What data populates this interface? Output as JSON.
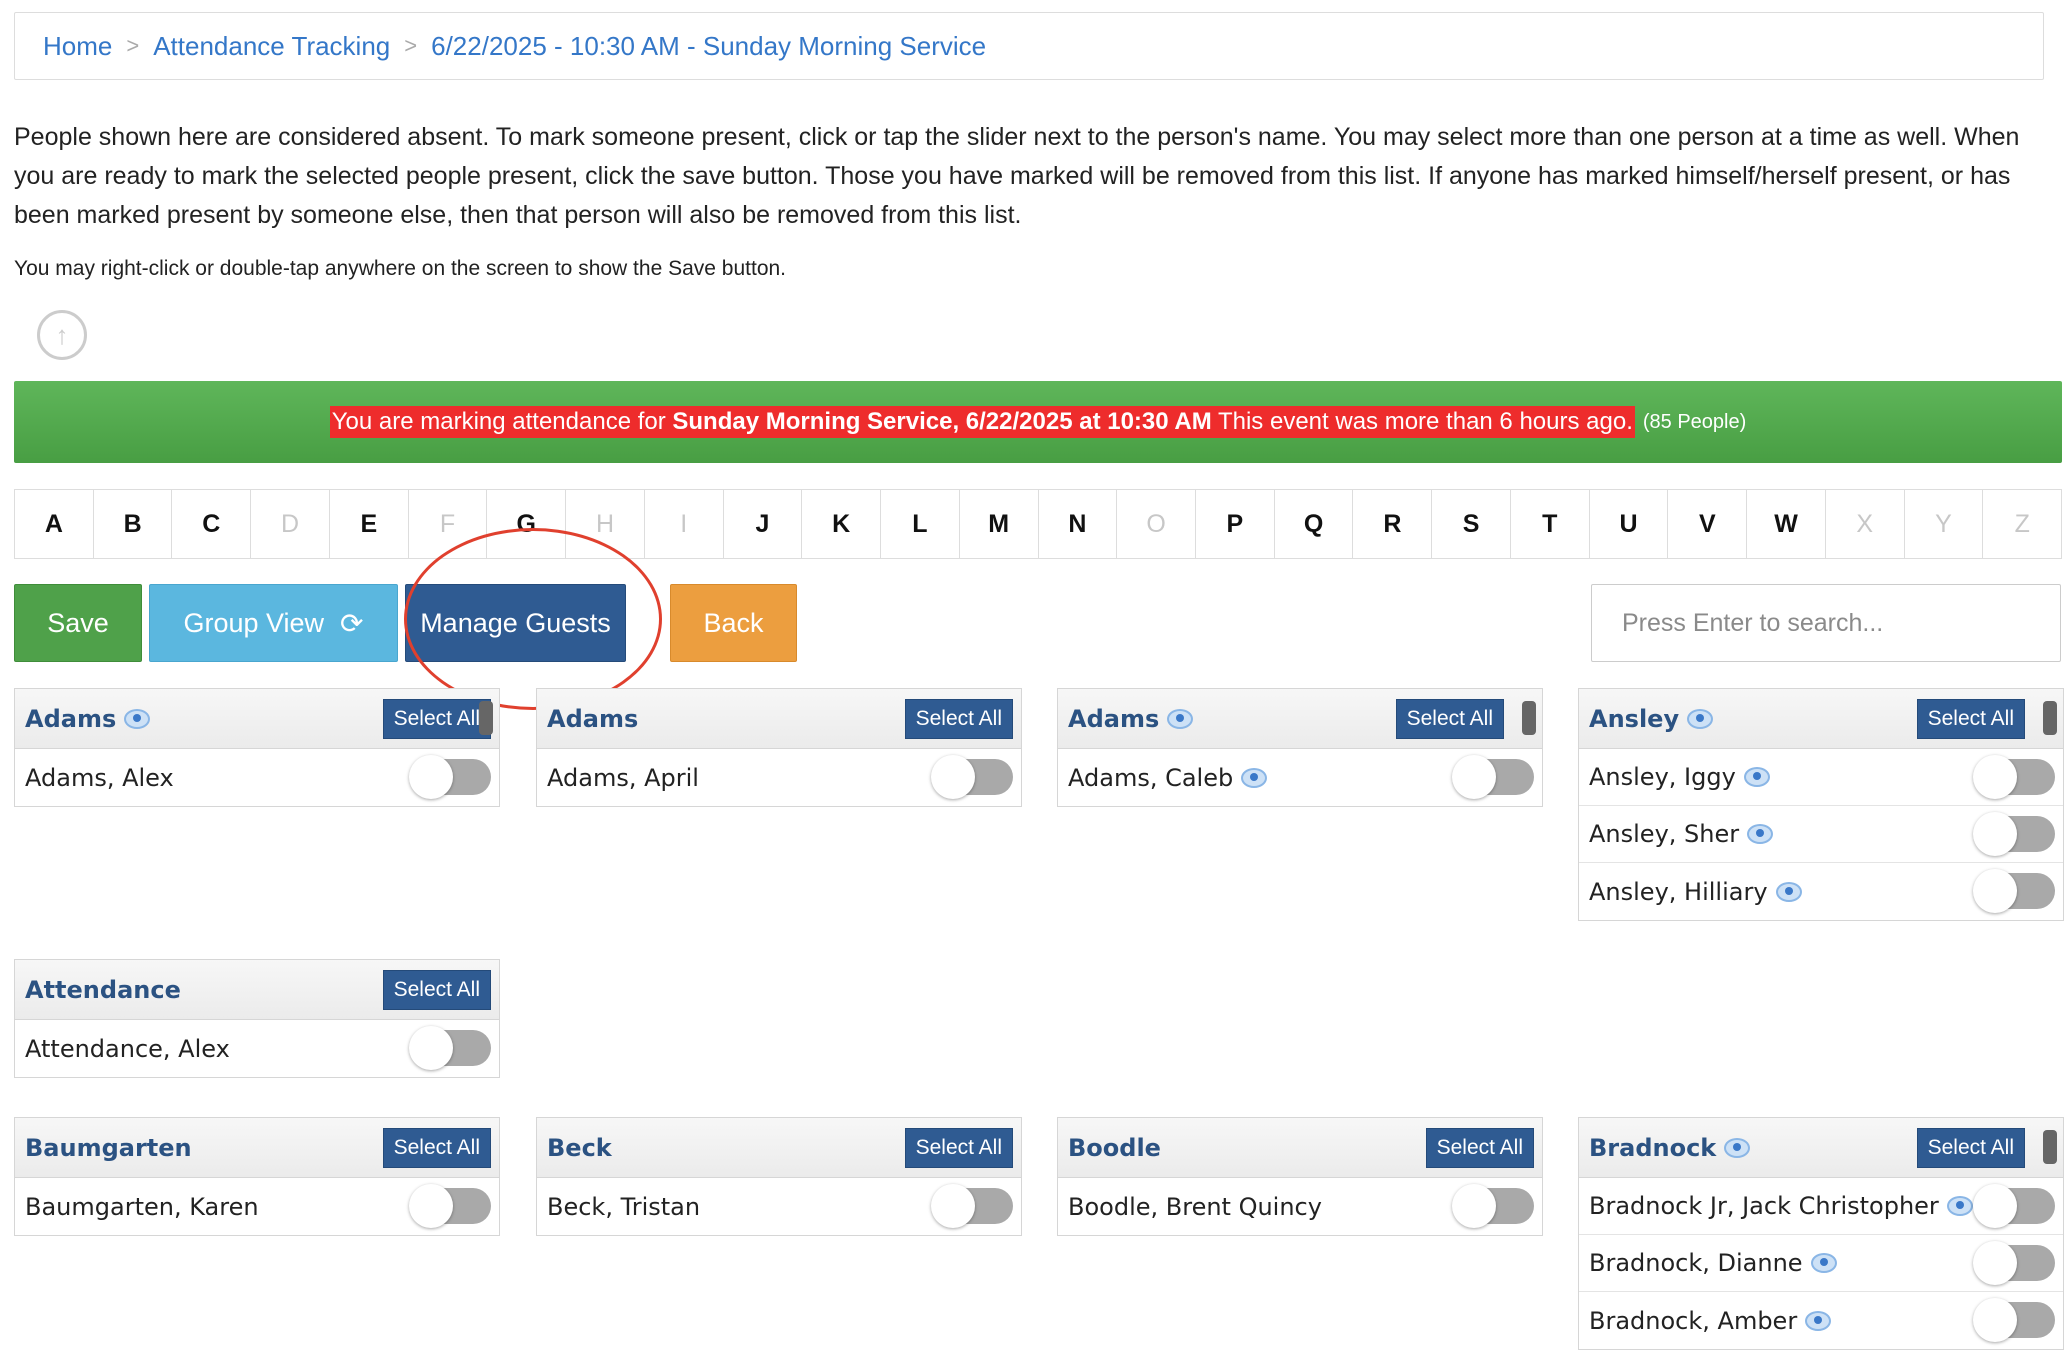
{
  "breadcrumb": {
    "home": "Home",
    "sep": ">",
    "attendance": "Attendance Tracking",
    "event": "6/22/2025 - 10:30 AM - Sunday Morning Service"
  },
  "intro": "People shown here are considered absent. To mark someone present, click or tap the slider next to the person's name. You may select more than one person at a time as well. When you are ready to mark the selected people present, click the save button. Those you have marked will be removed from this list. If anyone has marked himself/herself present, or has been marked present by someone else, then that person will also be removed from this list.",
  "hint": "You may right-click or double-tap anywhere on the screen to show the Save button.",
  "banner": {
    "prefix": "You are marking attendance for ",
    "event_bold": "Sunday Morning Service, 6/22/2025 at 10:30 AM",
    "suffix": " This event was more than 6 hours ago.",
    "count": "(85 People)",
    "color": "#52a94d",
    "highlight_color": "#ee2c2c"
  },
  "alphabet": [
    {
      "letter": "A",
      "enabled": true
    },
    {
      "letter": "B",
      "enabled": true
    },
    {
      "letter": "C",
      "enabled": true
    },
    {
      "letter": "D",
      "enabled": false
    },
    {
      "letter": "E",
      "enabled": true
    },
    {
      "letter": "F",
      "enabled": false
    },
    {
      "letter": "G",
      "enabled": true
    },
    {
      "letter": "H",
      "enabled": false
    },
    {
      "letter": "I",
      "enabled": false
    },
    {
      "letter": "J",
      "enabled": true
    },
    {
      "letter": "K",
      "enabled": true
    },
    {
      "letter": "L",
      "enabled": true
    },
    {
      "letter": "M",
      "enabled": true
    },
    {
      "letter": "N",
      "enabled": true
    },
    {
      "letter": "O",
      "enabled": false
    },
    {
      "letter": "P",
      "enabled": true
    },
    {
      "letter": "Q",
      "enabled": true
    },
    {
      "letter": "R",
      "enabled": true
    },
    {
      "letter": "S",
      "enabled": true
    },
    {
      "letter": "T",
      "enabled": true
    },
    {
      "letter": "U",
      "enabled": true
    },
    {
      "letter": "V",
      "enabled": true
    },
    {
      "letter": "W",
      "enabled": true
    },
    {
      "letter": "X",
      "enabled": false
    },
    {
      "letter": "Y",
      "enabled": false
    },
    {
      "letter": "Z",
      "enabled": false
    }
  ],
  "toolbar": {
    "save": "Save",
    "group_view": "Group View",
    "group_view_icon": "refresh-icon",
    "manage_guests": "Manage Guests",
    "back": "Back",
    "search_placeholder": "Press Enter to search...",
    "colors": {
      "save": "#4fa14a",
      "group_view": "#5bb7df",
      "manage_guests": "#2f5b92",
      "back": "#ec9e3f",
      "annotation_circle": "#e0402e"
    }
  },
  "select_all_label": "Select All",
  "groups": [
    {
      "title": "Adams",
      "eye": true,
      "scrollbar": true,
      "members": [
        {
          "name": "Adams, Alex",
          "eye": false
        }
      ]
    },
    {
      "title": "Adams",
      "eye": false,
      "scrollbar": false,
      "members": [
        {
          "name": "Adams, April",
          "eye": false
        }
      ]
    },
    {
      "title": "Adams",
      "eye": true,
      "scrollbar": true,
      "members": [
        {
          "name": "Adams, Caleb",
          "eye": true
        }
      ]
    },
    {
      "title": "Ansley",
      "eye": true,
      "scrollbar": true,
      "members": [
        {
          "name": "Ansley, Iggy",
          "eye": true
        },
        {
          "name": "Ansley, Sher",
          "eye": true
        },
        {
          "name": "Ansley, Hilliary",
          "eye": true
        }
      ]
    },
    {
      "title": "Attendance",
      "eye": false,
      "scrollbar": false,
      "members": [
        {
          "name": "Attendance, Alex",
          "eye": false
        }
      ]
    },
    {
      "title": "Baumgarten",
      "eye": false,
      "scrollbar": false,
      "members": [
        {
          "name": "Baumgarten, Karen",
          "eye": false
        }
      ]
    },
    {
      "title": "Beck",
      "eye": false,
      "scrollbar": false,
      "members": [
        {
          "name": "Beck, Tristan",
          "eye": false
        }
      ]
    },
    {
      "title": "Boodle",
      "eye": false,
      "scrollbar": false,
      "members": [
        {
          "name": "Boodle, Brent Quincy",
          "eye": false
        }
      ]
    },
    {
      "title": "Bradnock",
      "eye": true,
      "scrollbar": true,
      "members": [
        {
          "name": "Bradnock Jr, Jack Christopher",
          "eye": true
        },
        {
          "name": "Bradnock, Dianne",
          "eye": true
        },
        {
          "name": "Bradnock, Amber",
          "eye": true
        }
      ]
    }
  ]
}
